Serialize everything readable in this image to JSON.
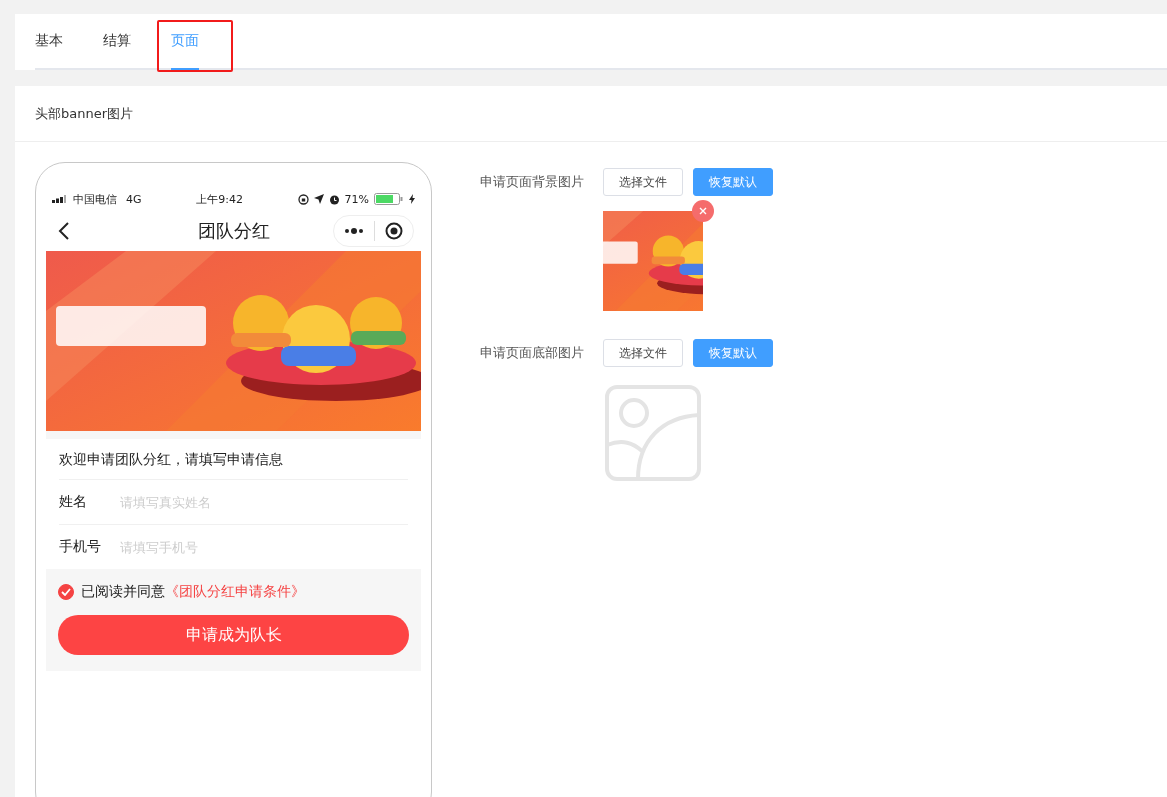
{
  "tabs": [
    {
      "label": "基本",
      "selected": false,
      "highlighted": false
    },
    {
      "label": "结算",
      "selected": false,
      "highlighted": false
    },
    {
      "label": "页面",
      "selected": true,
      "highlighted": true
    }
  ],
  "section_title": "头部banner图片",
  "phone": {
    "status_bar": {
      "carrier": "中国电信",
      "network": "4G",
      "time": "上午9:42",
      "battery": "71%"
    },
    "nav": {
      "title": "团队分红"
    },
    "banner": {
      "kind": "picture"
    },
    "form": {
      "intro": "欢迎申请团队分红，请填写申请信息",
      "fields": [
        {
          "label": "姓名",
          "placeholder": "请填写真实姓名"
        },
        {
          "label": "手机号",
          "placeholder": "请填写手机号"
        }
      ],
      "agreement": {
        "checked": true,
        "text": "已阅读并同意",
        "link": "《团队分红申请条件》"
      },
      "submit": "申请成为队长"
    }
  },
  "settings": [
    {
      "label": "申请页面背景图片",
      "choose": "选择文件",
      "reset": "恢复默认",
      "image": {
        "kind": "picture",
        "removable": true
      }
    },
    {
      "label": "申请页面底部图片",
      "choose": "选择文件",
      "reset": "恢复默认",
      "image": {
        "kind": "empty",
        "removable": false
      }
    }
  ]
}
